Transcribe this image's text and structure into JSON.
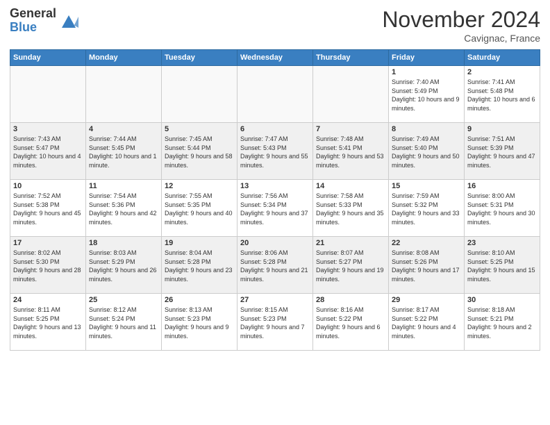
{
  "logo": {
    "general": "General",
    "blue": "Blue"
  },
  "title": "November 2024",
  "location": "Cavignac, France",
  "weekdays": [
    "Sunday",
    "Monday",
    "Tuesday",
    "Wednesday",
    "Thursday",
    "Friday",
    "Saturday"
  ],
  "weeks": [
    [
      {
        "day": "",
        "info": ""
      },
      {
        "day": "",
        "info": ""
      },
      {
        "day": "",
        "info": ""
      },
      {
        "day": "",
        "info": ""
      },
      {
        "day": "",
        "info": ""
      },
      {
        "day": "1",
        "info": "Sunrise: 7:40 AM\nSunset: 5:49 PM\nDaylight: 10 hours and 9 minutes."
      },
      {
        "day": "2",
        "info": "Sunrise: 7:41 AM\nSunset: 5:48 PM\nDaylight: 10 hours and 6 minutes."
      }
    ],
    [
      {
        "day": "3",
        "info": "Sunrise: 7:43 AM\nSunset: 5:47 PM\nDaylight: 10 hours and 4 minutes."
      },
      {
        "day": "4",
        "info": "Sunrise: 7:44 AM\nSunset: 5:45 PM\nDaylight: 10 hours and 1 minute."
      },
      {
        "day": "5",
        "info": "Sunrise: 7:45 AM\nSunset: 5:44 PM\nDaylight: 9 hours and 58 minutes."
      },
      {
        "day": "6",
        "info": "Sunrise: 7:47 AM\nSunset: 5:43 PM\nDaylight: 9 hours and 55 minutes."
      },
      {
        "day": "7",
        "info": "Sunrise: 7:48 AM\nSunset: 5:41 PM\nDaylight: 9 hours and 53 minutes."
      },
      {
        "day": "8",
        "info": "Sunrise: 7:49 AM\nSunset: 5:40 PM\nDaylight: 9 hours and 50 minutes."
      },
      {
        "day": "9",
        "info": "Sunrise: 7:51 AM\nSunset: 5:39 PM\nDaylight: 9 hours and 47 minutes."
      }
    ],
    [
      {
        "day": "10",
        "info": "Sunrise: 7:52 AM\nSunset: 5:38 PM\nDaylight: 9 hours and 45 minutes."
      },
      {
        "day": "11",
        "info": "Sunrise: 7:54 AM\nSunset: 5:36 PM\nDaylight: 9 hours and 42 minutes."
      },
      {
        "day": "12",
        "info": "Sunrise: 7:55 AM\nSunset: 5:35 PM\nDaylight: 9 hours and 40 minutes."
      },
      {
        "day": "13",
        "info": "Sunrise: 7:56 AM\nSunset: 5:34 PM\nDaylight: 9 hours and 37 minutes."
      },
      {
        "day": "14",
        "info": "Sunrise: 7:58 AM\nSunset: 5:33 PM\nDaylight: 9 hours and 35 minutes."
      },
      {
        "day": "15",
        "info": "Sunrise: 7:59 AM\nSunset: 5:32 PM\nDaylight: 9 hours and 33 minutes."
      },
      {
        "day": "16",
        "info": "Sunrise: 8:00 AM\nSunset: 5:31 PM\nDaylight: 9 hours and 30 minutes."
      }
    ],
    [
      {
        "day": "17",
        "info": "Sunrise: 8:02 AM\nSunset: 5:30 PM\nDaylight: 9 hours and 28 minutes."
      },
      {
        "day": "18",
        "info": "Sunrise: 8:03 AM\nSunset: 5:29 PM\nDaylight: 9 hours and 26 minutes."
      },
      {
        "day": "19",
        "info": "Sunrise: 8:04 AM\nSunset: 5:28 PM\nDaylight: 9 hours and 23 minutes."
      },
      {
        "day": "20",
        "info": "Sunrise: 8:06 AM\nSunset: 5:28 PM\nDaylight: 9 hours and 21 minutes."
      },
      {
        "day": "21",
        "info": "Sunrise: 8:07 AM\nSunset: 5:27 PM\nDaylight: 9 hours and 19 minutes."
      },
      {
        "day": "22",
        "info": "Sunrise: 8:08 AM\nSunset: 5:26 PM\nDaylight: 9 hours and 17 minutes."
      },
      {
        "day": "23",
        "info": "Sunrise: 8:10 AM\nSunset: 5:25 PM\nDaylight: 9 hours and 15 minutes."
      }
    ],
    [
      {
        "day": "24",
        "info": "Sunrise: 8:11 AM\nSunset: 5:25 PM\nDaylight: 9 hours and 13 minutes."
      },
      {
        "day": "25",
        "info": "Sunrise: 8:12 AM\nSunset: 5:24 PM\nDaylight: 9 hours and 11 minutes."
      },
      {
        "day": "26",
        "info": "Sunrise: 8:13 AM\nSunset: 5:23 PM\nDaylight: 9 hours and 9 minutes."
      },
      {
        "day": "27",
        "info": "Sunrise: 8:15 AM\nSunset: 5:23 PM\nDaylight: 9 hours and 7 minutes."
      },
      {
        "day": "28",
        "info": "Sunrise: 8:16 AM\nSunset: 5:22 PM\nDaylight: 9 hours and 6 minutes."
      },
      {
        "day": "29",
        "info": "Sunrise: 8:17 AM\nSunset: 5:22 PM\nDaylight: 9 hours and 4 minutes."
      },
      {
        "day": "30",
        "info": "Sunrise: 8:18 AM\nSunset: 5:21 PM\nDaylight: 9 hours and 2 minutes."
      }
    ]
  ]
}
